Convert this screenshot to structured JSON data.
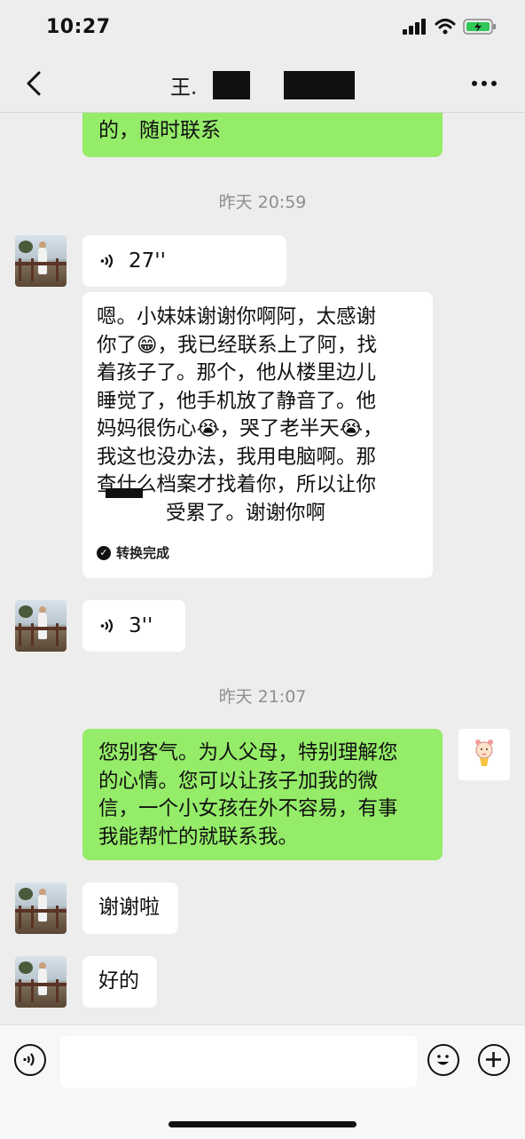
{
  "status": {
    "time": "10:27"
  },
  "header": {
    "title": "王."
  },
  "chat": {
    "prev_message": "的，随时联系",
    "timestamp1": "昨天 20:59",
    "voice1": {
      "duration": "27''"
    },
    "transcript": {
      "lines": [
        "嗯。小妹妹谢谢你啊阿，太感谢",
        "你了😁，我已经联系上了阿，找",
        "着孩子了。那个，他从楼里边儿",
        "睡觉了，他手机放了静音了。他",
        "妈妈很伤心😭，哭了老半天😭，",
        "我这也没办法，我用电脑啊。那",
        "查什么档案才找着你，所以让你",
        "受累了。谢谢你啊"
      ],
      "status": "转换完成"
    },
    "voice2": {
      "duration": "3''"
    },
    "timestamp2": "昨天 21:07",
    "my_message": {
      "lines": [
        "您别客气。为人父母，特别理解您",
        "的心情。您可以让孩子加我的微",
        "信，一个小女孩在外不容易，有事",
        "我能帮忙的就联系我。"
      ]
    },
    "reply1": "谢谢啦",
    "reply2": "好的"
  },
  "icons": {
    "back": "chevron-left-icon",
    "more": "more-icon",
    "voice_input": "voice-icon",
    "emoji": "emoji-icon",
    "plus": "plus-icon"
  },
  "colors": {
    "sent_bubble": "#95ec69",
    "received_bubble": "#ffffff",
    "background": "#ededed"
  }
}
